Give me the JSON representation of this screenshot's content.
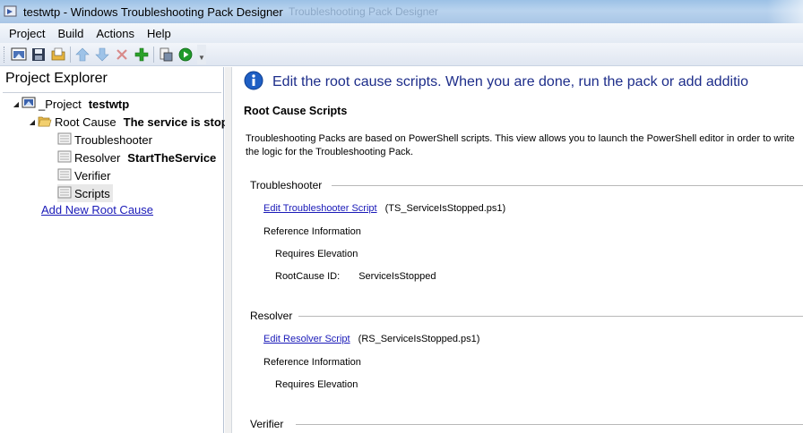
{
  "window": {
    "title": "testwtp - Windows Troubleshooting Pack Designer",
    "ghost_title": "Troubleshooting Pack Designer"
  },
  "menu": {
    "items": [
      "Project",
      "Build",
      "Actions",
      "Help"
    ]
  },
  "toolbar": {
    "icons": [
      "project-properties-icon",
      "save-icon",
      "open-folder-icon",
      "move-up-icon",
      "move-down-icon",
      "delete-icon",
      "add-icon",
      "build-icon",
      "run-icon"
    ],
    "colors": {
      "add": "#2aa12a",
      "run": "#1f9a2a",
      "delete": "#cc3333",
      "arrows": "#9ec3e8"
    }
  },
  "explorer": {
    "title": "Project Explorer",
    "project_label": "_Project",
    "project_name": "testwtp",
    "root_cause_label": "Root Cause",
    "root_cause_value": "The service is stop",
    "items": [
      {
        "label": "Troubleshooter",
        "value": ""
      },
      {
        "label": "Resolver",
        "value": "StartTheService"
      },
      {
        "label": "Verifier",
        "value": ""
      },
      {
        "label": "Scripts",
        "value": ""
      }
    ],
    "add_link": "Add New Root Cause"
  },
  "content": {
    "info_text": "Edit the root cause scripts. When you are done, run the pack or add additio",
    "heading": "Root Cause Scripts",
    "description": "Troubleshooting Packs are based on PowerShell scripts. This view allows you to launch the PowerShell editor in order to write the logic for the Troubleshooting Pack.",
    "troubleshooter": {
      "title": "Troubleshooter",
      "edit_link": "Edit Troubleshooter Script",
      "file": "(TS_ServiceIsStopped.ps1)",
      "reference_label": "Reference Information",
      "requires_elevation": "Requires Elevation",
      "rootcause_id_label": "RootCause ID:",
      "rootcause_id_value": "ServiceIsStopped"
    },
    "resolver": {
      "title": "Resolver",
      "edit_link": "Edit Resolver Script",
      "file": "(RS_ServiceIsStopped.ps1)",
      "reference_label": "Reference Information",
      "requires_elevation": "Requires Elevation"
    },
    "verifier": {
      "title": "Verifier"
    }
  },
  "colors": {
    "link": "#1a1ab8",
    "info_text": "#1d2d8a",
    "info_icon": "#1f5fc4",
    "titlebar": "#b9d3ee"
  }
}
